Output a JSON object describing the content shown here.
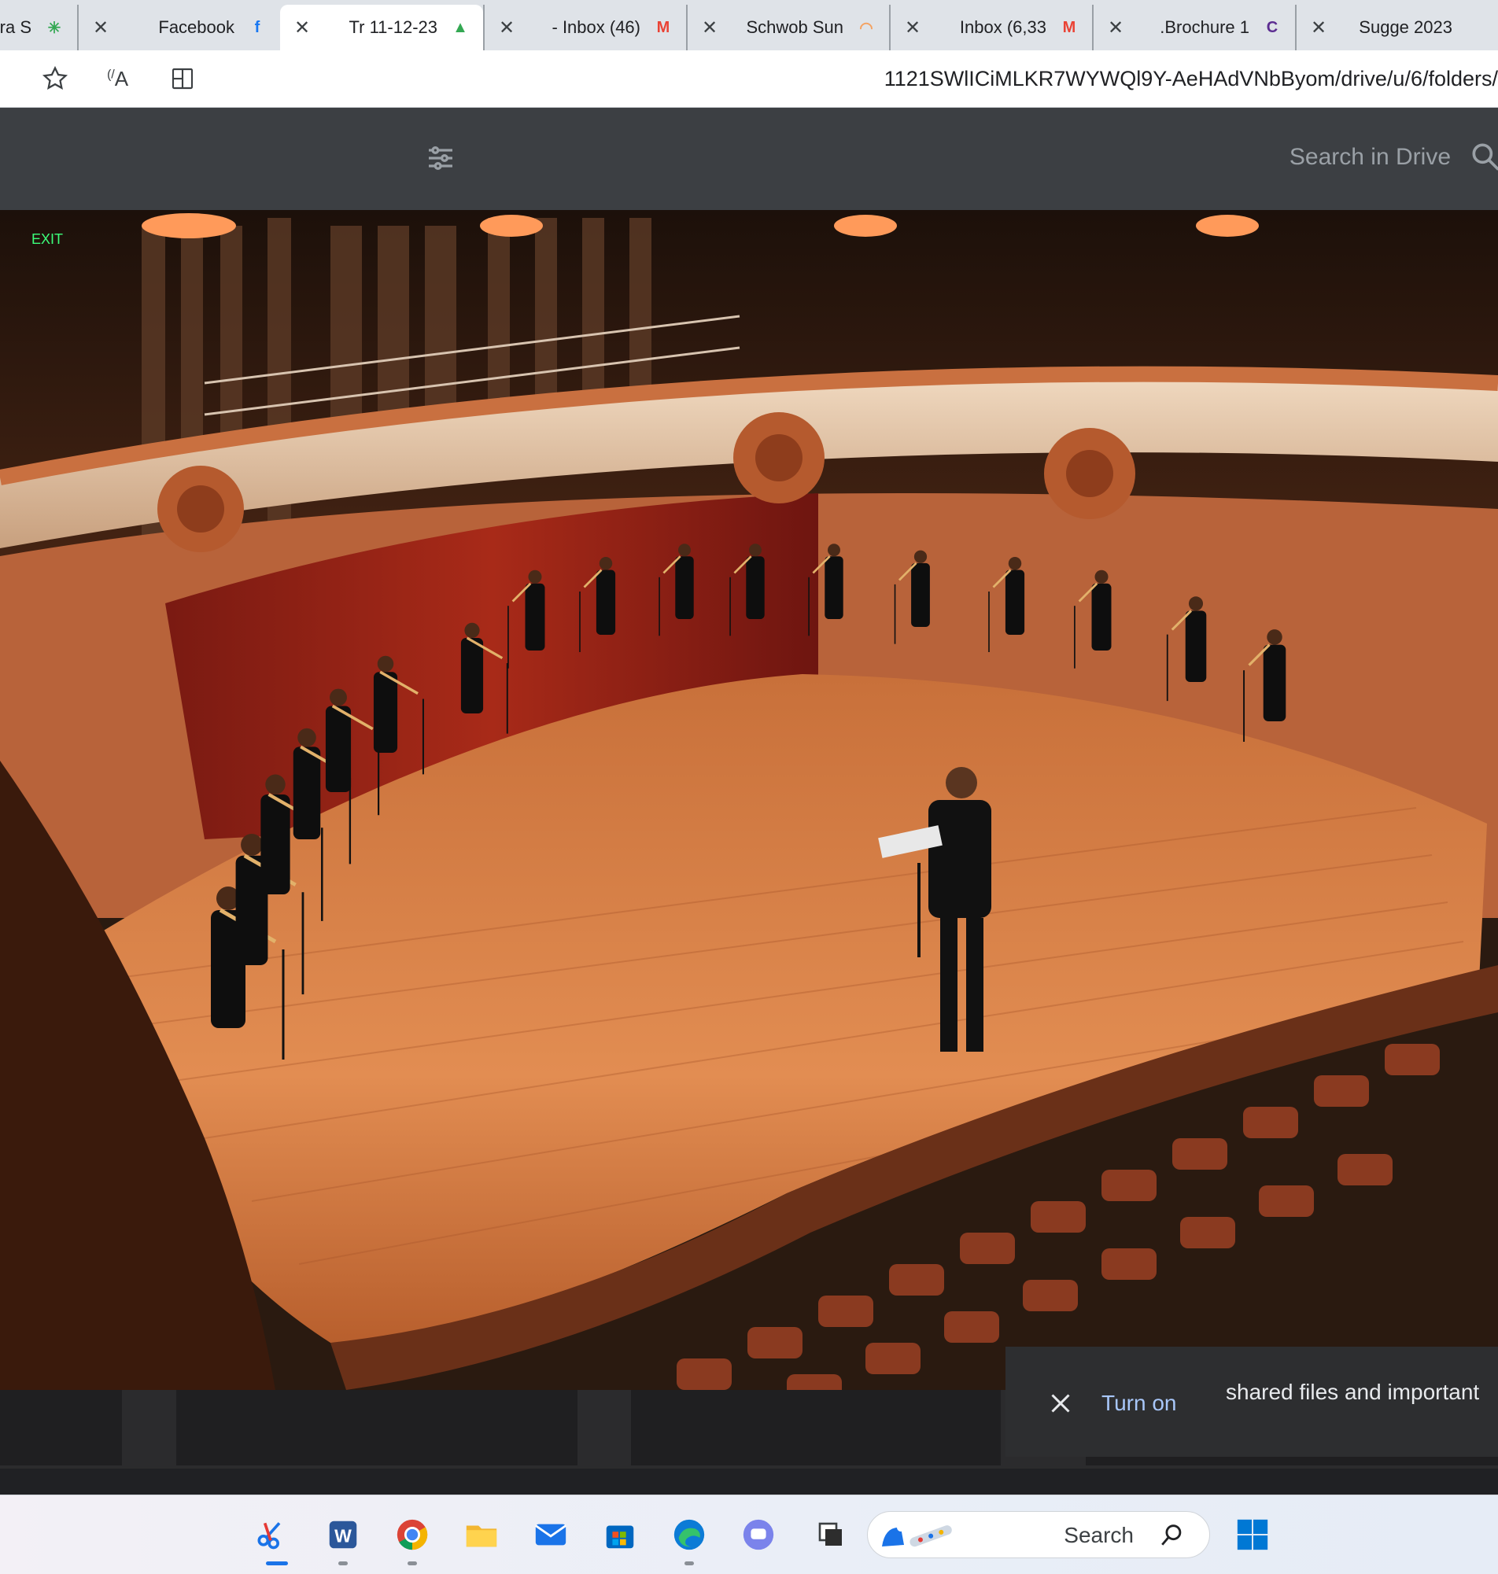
{
  "browser": {
    "tabs": [
      {
        "title": "2023 Sugge",
        "favicon": "document-icon"
      },
      {
        "title": "Brochure 1.",
        "favicon": "c-circle-icon"
      },
      {
        "title": "Inbox (6,33",
        "favicon": "gmail-icon"
      },
      {
        "title": "Schwob Sun",
        "favicon": "rainbow-icon"
      },
      {
        "title": "Inbox (46) -",
        "favicon": "gmail-icon"
      },
      {
        "title": "11-12-23 Tr",
        "favicon": "drive-icon"
      },
      {
        "title": "Facebook",
        "favicon": "facebook-icon"
      },
      {
        "title": "Clara S",
        "favicon": "sparkle-icon"
      }
    ],
    "active_tab_index": 5,
    "url_prefix": "om/drive/u/6/folders/",
    "url_path": "1121SWlICiMLKR7WYWQl9Y-AeHAdVNbBy"
  },
  "drive": {
    "search_placeholder": "Search in Drive"
  },
  "toast": {
    "message": "shared files and important",
    "action": "Turn on"
  },
  "taskbar": {
    "search_label": "Search"
  },
  "photo": {
    "description_icon": "concert-hall-photo",
    "exit_sign": "EXIT"
  }
}
